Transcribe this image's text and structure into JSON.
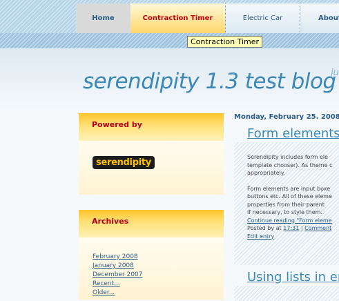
{
  "nav": {
    "tabs": [
      "Home",
      "Contraction Timer",
      "Electric Car",
      "About"
    ],
    "tooltip": "Contraction Timer"
  },
  "blog": {
    "title": "serendipity 1.3 test blog",
    "description": "ju"
  },
  "sidebar": {
    "powered": {
      "title": "Powered by",
      "logo_text": "serendipity"
    },
    "archives": {
      "title": "Archives",
      "links": [
        "February 2008",
        "January 2008",
        "December 2007",
        "Recent...",
        "Older..."
      ]
    }
  },
  "main": {
    "date": "Monday, February 25. 2008",
    "post1": {
      "title": "Form elements",
      "para1": [
        "Serendipity includes form ele",
        "template chooser). As theme c",
        "appropriately."
      ],
      "para2": [
        "Form elements are input boxe",
        "buttons etc. All of these eleme",
        "properties from their parent",
        "if necessary, to style them."
      ],
      "continue": "Continue reading \"Form eleme",
      "posted_by": "Posted by",
      "at": "at",
      "time": "17:31",
      "sep": "|",
      "comments": "Comment",
      "edit": "Edit entry"
    },
    "post2": {
      "title": "Using lists in en"
    }
  },
  "colors": {
    "accent": "#3a87b8",
    "tab_active": "#ffd66b",
    "sidebar_head": "#ffc42a",
    "link": "#2b5b8a"
  }
}
